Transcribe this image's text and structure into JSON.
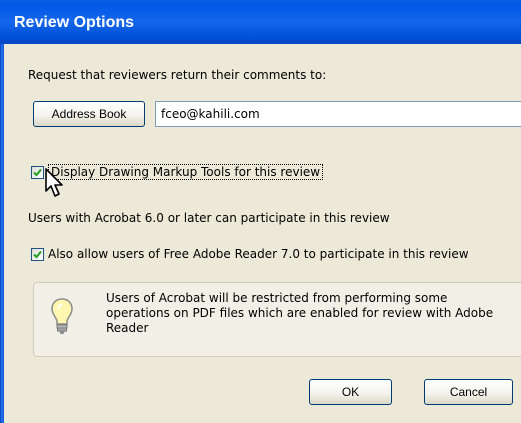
{
  "window": {
    "title": "Review Options"
  },
  "prompt_text": "Request that reviewers return their comments to:",
  "address_book_label": "Address Book",
  "email": {
    "value": "fceo@kahili.com"
  },
  "options": {
    "display_markup": {
      "label": "Display Drawing Markup Tools for this review",
      "checked": true
    },
    "info_text": "Users with Acrobat 6.0 or later can participate in this review",
    "allow_reader": {
      "label": "Also allow users of Free Adobe Reader 7.0 to participate in this review",
      "checked": true
    }
  },
  "notice": {
    "icon": "lightbulb-icon",
    "text": "Users of Acrobat will be restricted from performing some operations on PDF files which are enabled for review with Adobe Reader"
  },
  "buttons": {
    "ok": "OK",
    "cancel": "Cancel"
  },
  "colors": {
    "titlebar": "#0058e8",
    "dialog_bg": "#ece9d8",
    "checkmark": "#21a121"
  }
}
